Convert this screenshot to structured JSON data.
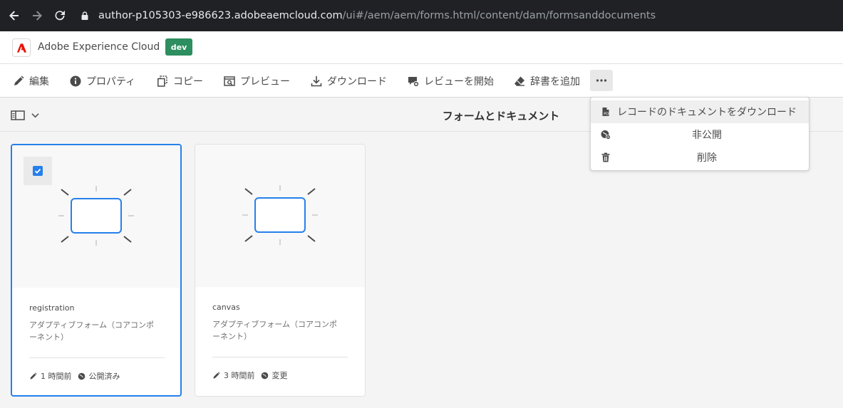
{
  "browser": {
    "url_host": "author-p105303-e986623.adobeaemcloud.com",
    "url_path": "/ui#/aem/aem/forms.html/content/dam/formsanddocuments"
  },
  "header": {
    "brand": "Adobe Experience Cloud",
    "env_badge": "dev",
    "accent": "#2d8e5f"
  },
  "actions": [
    {
      "label": "編集",
      "icon": "pencil-icon"
    },
    {
      "label": "プロパティ",
      "icon": "info-icon"
    },
    {
      "label": "コピー",
      "icon": "copy-icon"
    },
    {
      "label": "プレビュー",
      "icon": "preview-icon"
    },
    {
      "label": "ダウンロード",
      "icon": "download-icon"
    },
    {
      "label": "レビューを開始",
      "icon": "review-icon"
    },
    {
      "label": "辞書を追加",
      "icon": "eraser-icon"
    }
  ],
  "page_title": "フォームとドキュメント",
  "more_menu": {
    "items": [
      {
        "label": "レコードのドキュメントをダウンロード",
        "icon": "document-icon"
      },
      {
        "label": "非公開",
        "icon": "globe-remove-icon"
      },
      {
        "label": "削除",
        "icon": "trash-icon"
      }
    ]
  },
  "cards": [
    {
      "title": "registration",
      "subtitle_1": "アダプティブフォーム（コアコンポ",
      "subtitle_2": "ーネント）",
      "modified": "1 時間前",
      "status": "公開済み",
      "selected": true
    },
    {
      "title": "canvas",
      "subtitle_1": "アダプティブフォーム（コアコンポ",
      "subtitle_2": "ーネント）",
      "modified": "3 時間前",
      "status": "変更",
      "selected": false
    }
  ],
  "colors": {
    "selection": "#2680eb",
    "browser_bg": "#202124"
  }
}
